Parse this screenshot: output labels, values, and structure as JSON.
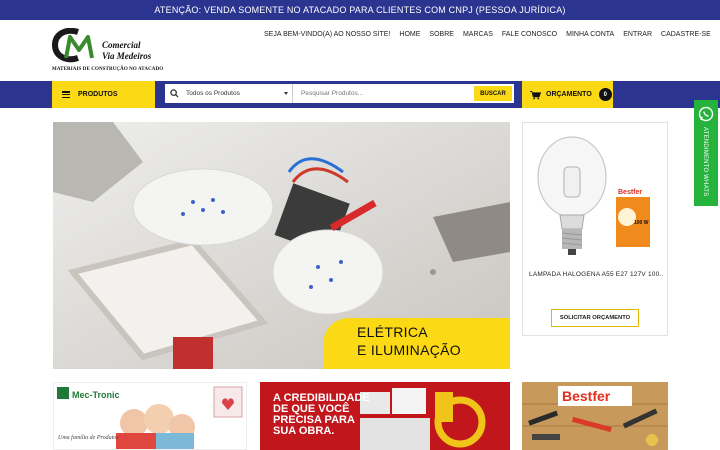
{
  "topbar": {
    "notice": "ATENÇÃO: VENDA SOMENTE NO ATACADO PARA CLIENTES COM CNPJ (PESSOA JURÍDICA)"
  },
  "logo": {
    "line1": "Comercial",
    "line2": "Via Medeiros",
    "tagline": "MATERIAIS DE CONSTRUÇÃO NO ATACADO"
  },
  "nav": {
    "welcome": "SEJA BEM-VINDO(A) AO NOSSO SITE!",
    "items": [
      "HOME",
      "SOBRE",
      "MARCAS",
      "FALE CONOSCO",
      "MINHA CONTA",
      "ENTRAR",
      "CADASTRE-SE"
    ]
  },
  "toolbar": {
    "products_label": "PRODUTOS",
    "category_selected": "Todos os Produtos",
    "search_placeholder": "Pesquisar Produtos...",
    "search_button": "BUSCAR",
    "quote_label": "ORÇAMENTO",
    "quote_count": "0"
  },
  "hero": {
    "caption_line1": "ELÉTRICA",
    "caption_line2": "E ILUMINAÇÃO"
  },
  "product": {
    "name": "LAMPADA HALOGENA A55 E27 127V 100...",
    "button": "SOLICITAR ORÇAMENTO",
    "package_brand": "Bestfer",
    "package_power": "100 W"
  },
  "whatsapp": {
    "label": "ATENDIMENTO WHATS"
  },
  "banners": {
    "b1": {
      "brand": "Mec-Tronic",
      "text": "Uma família de Produtos"
    },
    "b2": {
      "line1": "A CREDIBILIDADE",
      "line2": "DE QUE VOCÊ",
      "line3": "PRECISA PARA",
      "line4": "SUA OBRA."
    },
    "b3": {
      "brand": "Bestfer"
    }
  },
  "colors": {
    "brand_blue": "#2b3590",
    "brand_yellow": "#fbd914",
    "whatsapp_green": "#25b33c",
    "banner_red": "#c0161c"
  }
}
